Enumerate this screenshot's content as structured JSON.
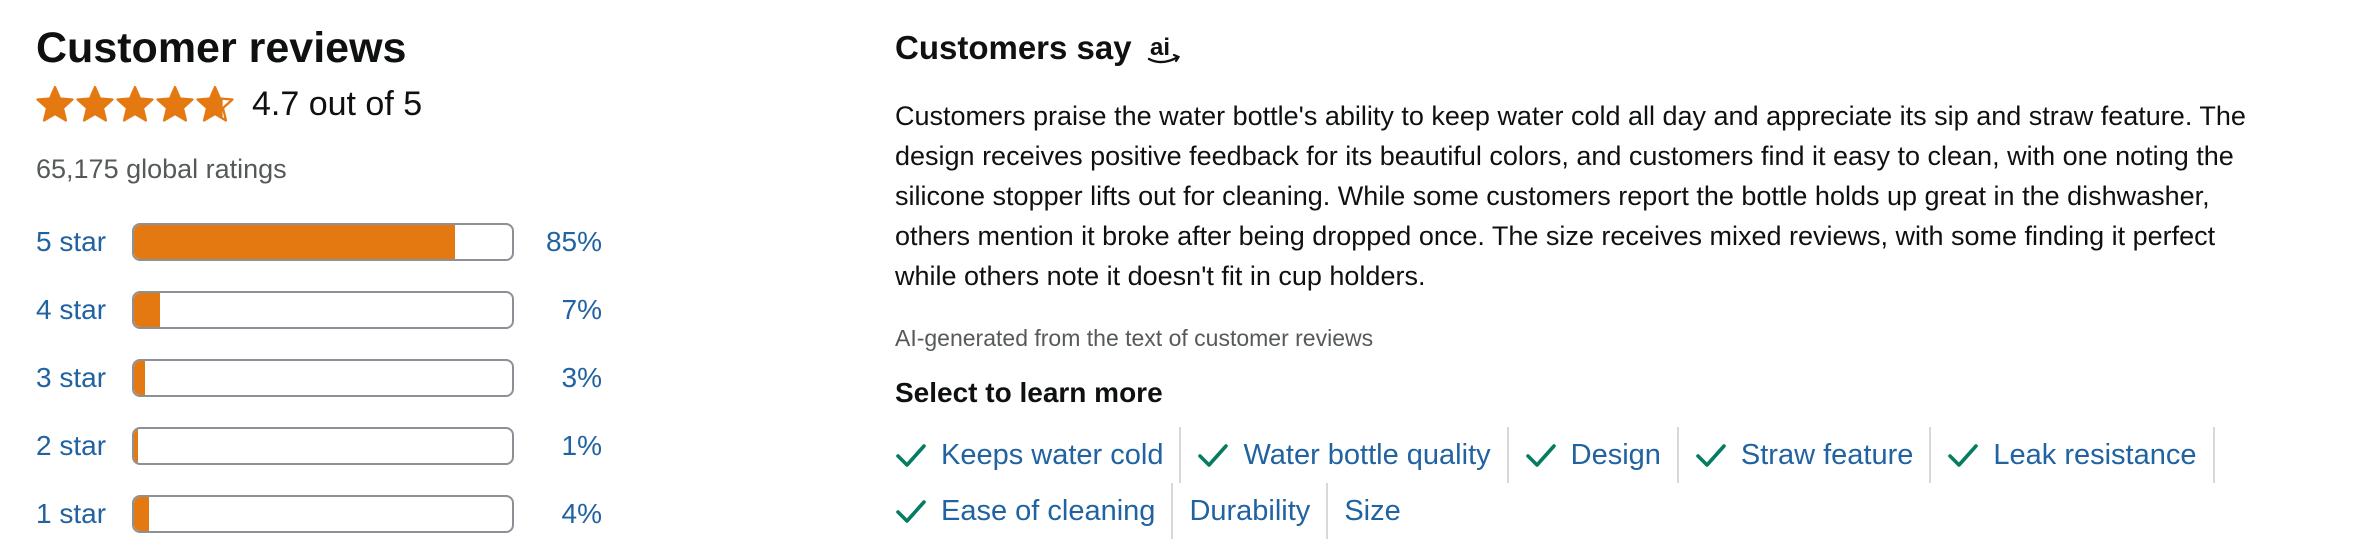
{
  "header": {
    "title": "Customer reviews"
  },
  "rating": {
    "stars_value": 4.7,
    "stars_max": 5,
    "text": "4.7 out of 5",
    "global_ratings": "65,175 global ratings",
    "star_color": "#e47911"
  },
  "histogram": [
    {
      "label": "5 star",
      "percent": 85,
      "percent_text": "85%"
    },
    {
      "label": "4 star",
      "percent": 7,
      "percent_text": "7%"
    },
    {
      "label": "3 star",
      "percent": 3,
      "percent_text": "3%"
    },
    {
      "label": "2 star",
      "percent": 1,
      "percent_text": "1%"
    },
    {
      "label": "1 star",
      "percent": 4,
      "percent_text": "4%"
    }
  ],
  "customers_say": {
    "heading": "Customers say",
    "icon": "ai-icon",
    "summary": "Customers praise the water bottle's ability to keep water cold all day and appreciate its sip and straw feature. The design receives positive feedback for its beautiful colors, and customers find it easy to clean, with one noting the silicone stopper lifts out for cleaning. While some customers report the bottle holds up great in the dishwasher, others mention it broke after being dropped once. The size receives mixed reviews, with some finding it perfect while others note it doesn't fit in cup holders.",
    "ai_note": "AI-generated from the text of customer reviews",
    "learn_more": "Select to learn more"
  },
  "aspects": [
    {
      "label": "Keeps water cold",
      "positive": true
    },
    {
      "label": "Water bottle quality",
      "positive": true
    },
    {
      "label": "Design",
      "positive": true
    },
    {
      "label": "Straw feature",
      "positive": true
    },
    {
      "label": "Leak resistance",
      "positive": true
    },
    {
      "label": "Ease of cleaning",
      "positive": true
    },
    {
      "label": "Durability",
      "positive": false
    },
    {
      "label": "Size",
      "positive": false
    }
  ],
  "colors": {
    "link": "#2162a1",
    "check": "#067d62",
    "bar_fill": "#e47911"
  }
}
